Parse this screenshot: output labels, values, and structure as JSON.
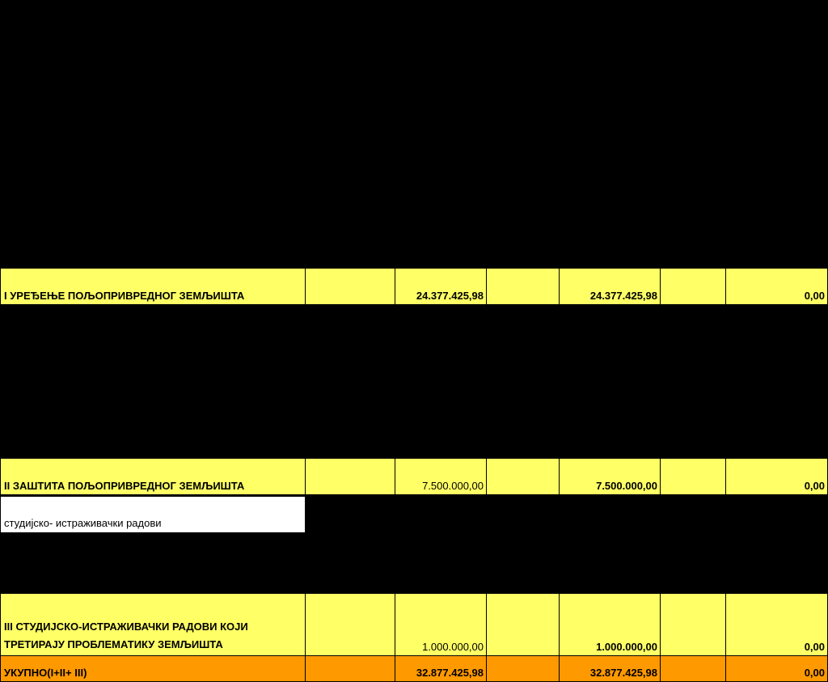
{
  "header": {
    "caption": "",
    "col_name": "",
    "col_unit": "",
    "col_total": "",
    "col_source": "",
    "col_pct1": "",
    "col_amt1": "",
    "col_pct2": "",
    "col_amt2": ""
  },
  "sections": {
    "s1": {
      "title": "I УРЕЂЕЊЕ ПОЉОПРИВРЕДНОГ ЗЕМЉИШТА",
      "total": "24.377.425,98",
      "source_total": "24.377.425,98",
      "other": "0,00"
    },
    "s2": {
      "title": "II ЗАШТИТА ПОЉОПРИВРЕДНОГ ЗЕМЉИШТА",
      "total": "7.500.000,00",
      "source_total": "7.500.000,00",
      "other": "0,00"
    },
    "s3": {
      "title_line1": "III СТУДИЈСКО-ИСТРАЖИВАЧКИ РАДОВИ КОЈИ",
      "title_line2": "ТРЕТИРАЈУ ПРОБЛЕМАТИКУ ЗЕМЉИШТА",
      "item": "студијско- истраживачки радови",
      "total": "1.000.000,00",
      "source_total": "1.000.000,00",
      "other": "0,00"
    },
    "grand": {
      "title": "УКУПНО(I+II+ III)",
      "total": "32.877.425,98",
      "source_total": "32.877.425,98",
      "other": "0,00"
    }
  },
  "colors": {
    "section": "#ffff66",
    "grand_total": "#ff9900",
    "background": "#000000"
  }
}
